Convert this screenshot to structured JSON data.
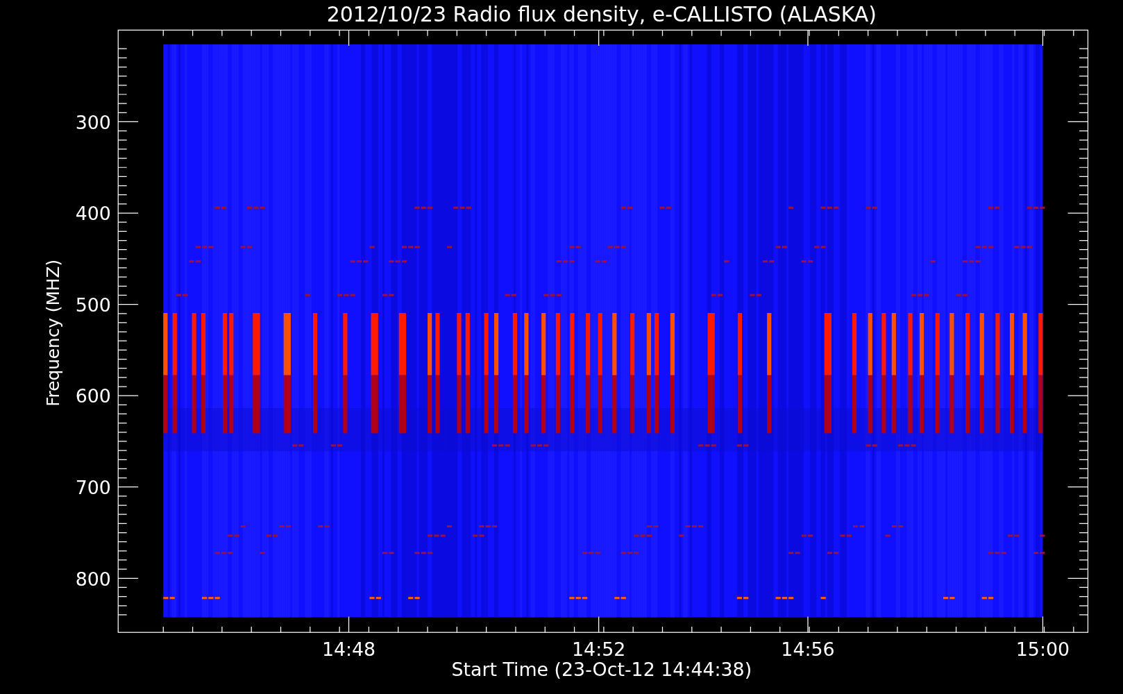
{
  "title": "2012/10/23  Radio flux density, e-CALLISTO (ALASKA)",
  "y_axis": {
    "label": "Frequency (MHZ)",
    "ticks": [
      "300",
      "400",
      "500",
      "600",
      "700",
      "800"
    ]
  },
  "x_axis": {
    "label": "Start Time (23-Oct-12 14:44:38)",
    "ticks": [
      "14:48",
      "14:52",
      "14:56",
      "15:00"
    ]
  }
}
